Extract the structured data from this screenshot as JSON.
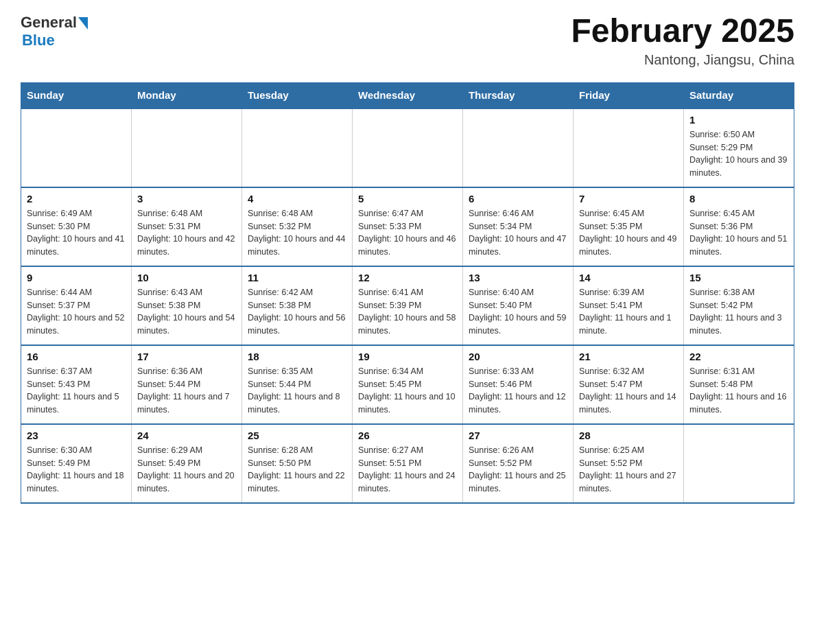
{
  "logo": {
    "general": "General",
    "blue": "Blue"
  },
  "title": "February 2025",
  "subtitle": "Nantong, Jiangsu, China",
  "days_of_week": [
    "Sunday",
    "Monday",
    "Tuesday",
    "Wednesday",
    "Thursday",
    "Friday",
    "Saturday"
  ],
  "weeks": [
    [
      {
        "day": "",
        "info": ""
      },
      {
        "day": "",
        "info": ""
      },
      {
        "day": "",
        "info": ""
      },
      {
        "day": "",
        "info": ""
      },
      {
        "day": "",
        "info": ""
      },
      {
        "day": "",
        "info": ""
      },
      {
        "day": "1",
        "info": "Sunrise: 6:50 AM\nSunset: 5:29 PM\nDaylight: 10 hours and 39 minutes."
      }
    ],
    [
      {
        "day": "2",
        "info": "Sunrise: 6:49 AM\nSunset: 5:30 PM\nDaylight: 10 hours and 41 minutes."
      },
      {
        "day": "3",
        "info": "Sunrise: 6:48 AM\nSunset: 5:31 PM\nDaylight: 10 hours and 42 minutes."
      },
      {
        "day": "4",
        "info": "Sunrise: 6:48 AM\nSunset: 5:32 PM\nDaylight: 10 hours and 44 minutes."
      },
      {
        "day": "5",
        "info": "Sunrise: 6:47 AM\nSunset: 5:33 PM\nDaylight: 10 hours and 46 minutes."
      },
      {
        "day": "6",
        "info": "Sunrise: 6:46 AM\nSunset: 5:34 PM\nDaylight: 10 hours and 47 minutes."
      },
      {
        "day": "7",
        "info": "Sunrise: 6:45 AM\nSunset: 5:35 PM\nDaylight: 10 hours and 49 minutes."
      },
      {
        "day": "8",
        "info": "Sunrise: 6:45 AM\nSunset: 5:36 PM\nDaylight: 10 hours and 51 minutes."
      }
    ],
    [
      {
        "day": "9",
        "info": "Sunrise: 6:44 AM\nSunset: 5:37 PM\nDaylight: 10 hours and 52 minutes."
      },
      {
        "day": "10",
        "info": "Sunrise: 6:43 AM\nSunset: 5:38 PM\nDaylight: 10 hours and 54 minutes."
      },
      {
        "day": "11",
        "info": "Sunrise: 6:42 AM\nSunset: 5:38 PM\nDaylight: 10 hours and 56 minutes."
      },
      {
        "day": "12",
        "info": "Sunrise: 6:41 AM\nSunset: 5:39 PM\nDaylight: 10 hours and 58 minutes."
      },
      {
        "day": "13",
        "info": "Sunrise: 6:40 AM\nSunset: 5:40 PM\nDaylight: 10 hours and 59 minutes."
      },
      {
        "day": "14",
        "info": "Sunrise: 6:39 AM\nSunset: 5:41 PM\nDaylight: 11 hours and 1 minute."
      },
      {
        "day": "15",
        "info": "Sunrise: 6:38 AM\nSunset: 5:42 PM\nDaylight: 11 hours and 3 minutes."
      }
    ],
    [
      {
        "day": "16",
        "info": "Sunrise: 6:37 AM\nSunset: 5:43 PM\nDaylight: 11 hours and 5 minutes."
      },
      {
        "day": "17",
        "info": "Sunrise: 6:36 AM\nSunset: 5:44 PM\nDaylight: 11 hours and 7 minutes."
      },
      {
        "day": "18",
        "info": "Sunrise: 6:35 AM\nSunset: 5:44 PM\nDaylight: 11 hours and 8 minutes."
      },
      {
        "day": "19",
        "info": "Sunrise: 6:34 AM\nSunset: 5:45 PM\nDaylight: 11 hours and 10 minutes."
      },
      {
        "day": "20",
        "info": "Sunrise: 6:33 AM\nSunset: 5:46 PM\nDaylight: 11 hours and 12 minutes."
      },
      {
        "day": "21",
        "info": "Sunrise: 6:32 AM\nSunset: 5:47 PM\nDaylight: 11 hours and 14 minutes."
      },
      {
        "day": "22",
        "info": "Sunrise: 6:31 AM\nSunset: 5:48 PM\nDaylight: 11 hours and 16 minutes."
      }
    ],
    [
      {
        "day": "23",
        "info": "Sunrise: 6:30 AM\nSunset: 5:49 PM\nDaylight: 11 hours and 18 minutes."
      },
      {
        "day": "24",
        "info": "Sunrise: 6:29 AM\nSunset: 5:49 PM\nDaylight: 11 hours and 20 minutes."
      },
      {
        "day": "25",
        "info": "Sunrise: 6:28 AM\nSunset: 5:50 PM\nDaylight: 11 hours and 22 minutes."
      },
      {
        "day": "26",
        "info": "Sunrise: 6:27 AM\nSunset: 5:51 PM\nDaylight: 11 hours and 24 minutes."
      },
      {
        "day": "27",
        "info": "Sunrise: 6:26 AM\nSunset: 5:52 PM\nDaylight: 11 hours and 25 minutes."
      },
      {
        "day": "28",
        "info": "Sunrise: 6:25 AM\nSunset: 5:52 PM\nDaylight: 11 hours and 27 minutes."
      },
      {
        "day": "",
        "info": ""
      }
    ]
  ]
}
